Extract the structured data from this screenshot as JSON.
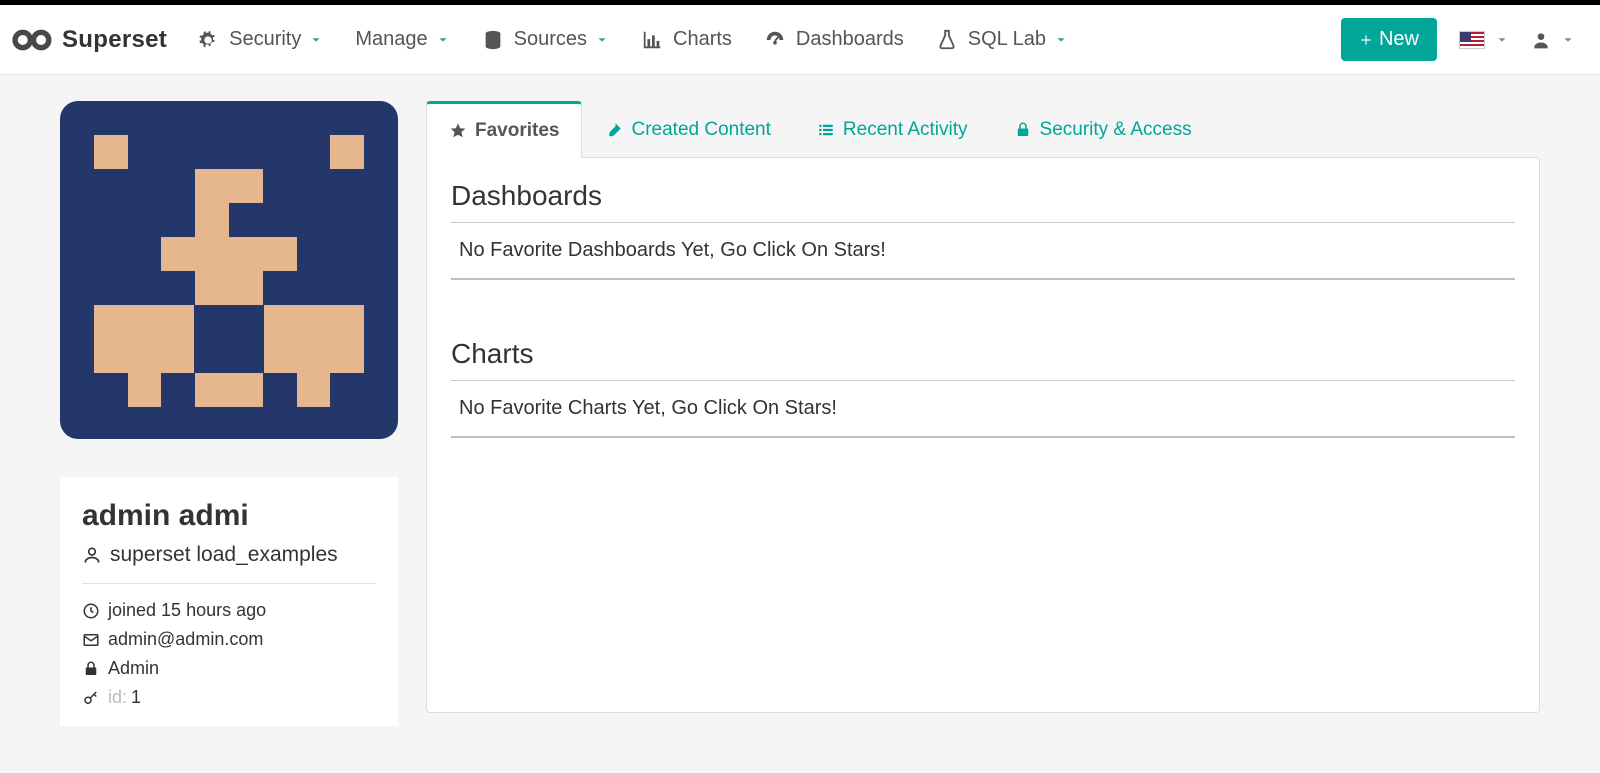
{
  "brand": {
    "name": "Superset"
  },
  "nav": {
    "security": "Security",
    "manage": "Manage",
    "sources": "Sources",
    "charts": "Charts",
    "dashboards": "Dashboards",
    "sqllab": "SQL Lab"
  },
  "new_button": {
    "label": "New"
  },
  "tabs": {
    "favorites": "Favorites",
    "created": "Created Content",
    "recent": "Recent Activity",
    "security": "Security & Access"
  },
  "favorites": {
    "dashboards_heading": "Dashboards",
    "dashboards_empty": "No Favorite Dashboards Yet, Go Click On Stars!",
    "charts_heading": "Charts",
    "charts_empty": "No Favorite Charts Yet, Go Click On Stars!"
  },
  "profile": {
    "display_name": "admin admi",
    "username": "superset load_examples",
    "joined": "joined 15 hours ago",
    "email": "admin@admin.com",
    "role": "Admin",
    "id_label": "id:",
    "id_value": "1"
  },
  "colors": {
    "accent": "#00a699",
    "avatar_bg": "#24376b",
    "avatar_fg": "#e6b78e"
  }
}
